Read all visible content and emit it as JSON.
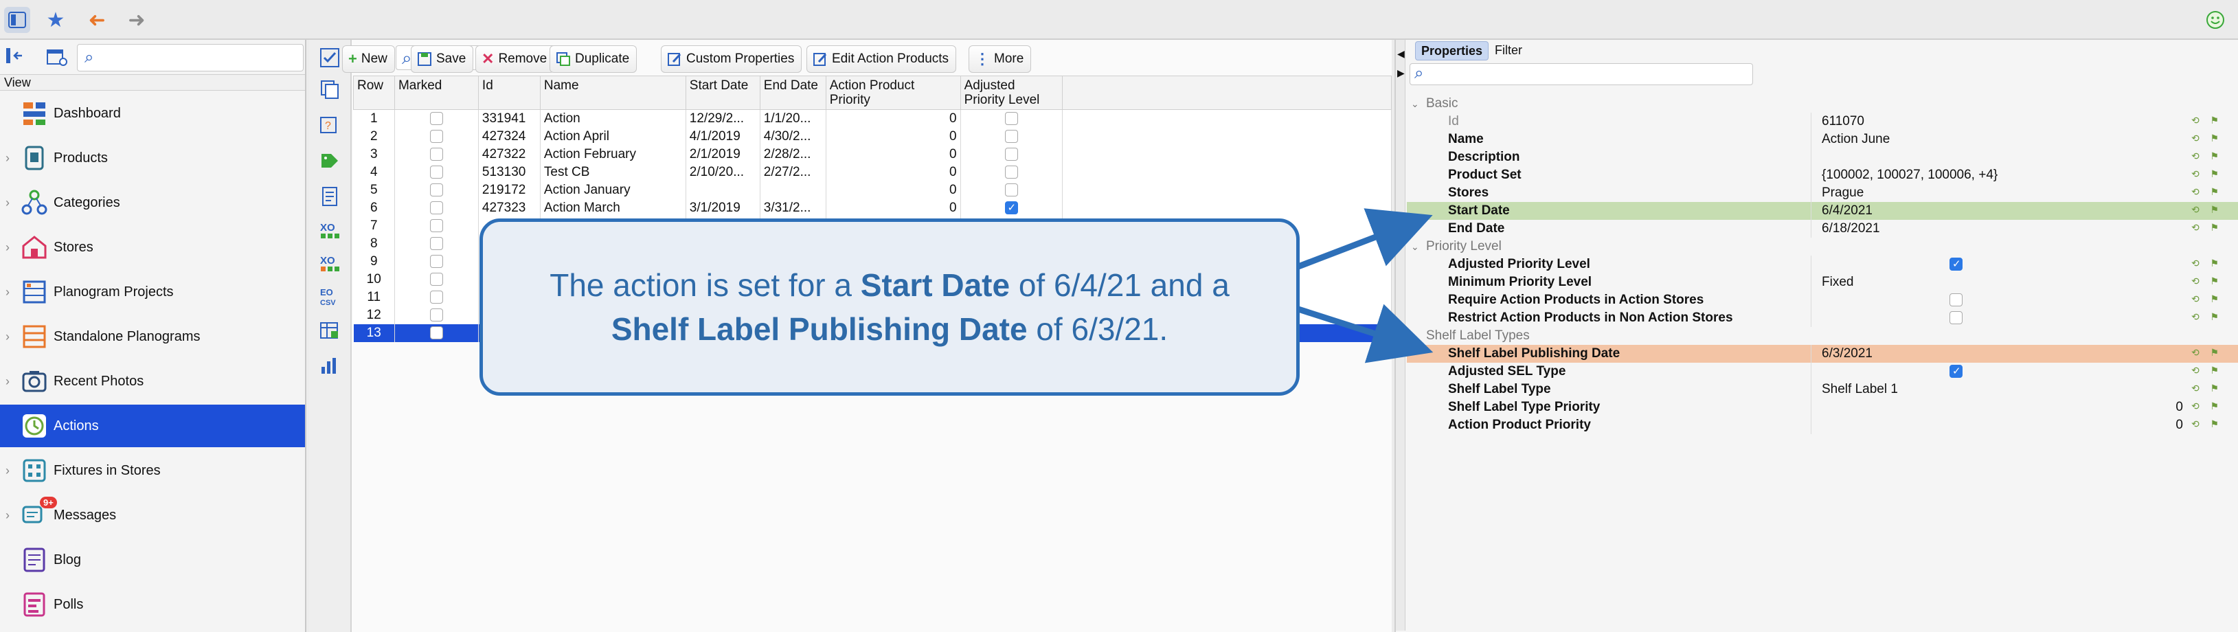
{
  "toolbar": {
    "icons": [
      "sidebar-toggle-icon",
      "star-icon",
      "back-arrow-icon",
      "forward-arrow-icon"
    ],
    "status_icon": "smiley-icon"
  },
  "left": {
    "search_placeholder": "",
    "view_label": "View",
    "items": [
      {
        "label": "Dashboard",
        "icon": "dashboard-icon",
        "chevron": false
      },
      {
        "label": "Products",
        "icon": "products-icon",
        "chevron": true
      },
      {
        "label": "Categories",
        "icon": "categories-icon",
        "chevron": true
      },
      {
        "label": "Stores",
        "icon": "stores-icon",
        "chevron": true
      },
      {
        "label": "Planogram Projects",
        "icon": "planogram-projects-icon",
        "chevron": true
      },
      {
        "label": "Standalone Planograms",
        "icon": "standalone-planograms-icon",
        "chevron": true
      },
      {
        "label": "Recent Photos",
        "icon": "camera-icon",
        "chevron": true
      },
      {
        "label": "Actions",
        "icon": "actions-icon",
        "chevron": false,
        "selected": true
      },
      {
        "label": "Fixtures in Stores",
        "icon": "fixtures-icon",
        "chevron": true
      },
      {
        "label": "Messages",
        "icon": "messages-icon",
        "chevron": true,
        "badge": "9+"
      },
      {
        "label": "Blog",
        "icon": "blog-icon",
        "chevron": false
      },
      {
        "label": "Polls",
        "icon": "polls-icon",
        "chevron": false
      }
    ]
  },
  "middle": {
    "search_placeholder": "",
    "buttons": [
      {
        "label": "New",
        "icon": "plus-icon"
      },
      {
        "label": "Save",
        "icon": "save-icon"
      },
      {
        "label": "Remove",
        "icon": "remove-icon"
      },
      {
        "label": "Duplicate",
        "icon": "duplicate-icon"
      },
      {
        "label": "Custom Properties",
        "icon": "edit-icon"
      },
      {
        "label": "Edit Action Products",
        "icon": "edit-icon"
      },
      {
        "label": "More",
        "icon": "more-icon"
      }
    ],
    "columns": [
      "Row",
      "Marked",
      "Id",
      "Name",
      "Start Date",
      "End Date",
      "Action Product Priority",
      "Adjusted Priority Level"
    ],
    "rows": [
      {
        "row": "1",
        "id": "331941",
        "name": "Action",
        "start": "12/29/2...",
        "end": "1/1/20...",
        "priority": "0",
        "adjusted": false
      },
      {
        "row": "2",
        "id": "427324",
        "name": "Action April",
        "start": "4/1/2019",
        "end": "4/30/2...",
        "priority": "0",
        "adjusted": false
      },
      {
        "row": "3",
        "id": "427322",
        "name": "Action February",
        "start": "2/1/2019",
        "end": "2/28/2...",
        "priority": "0",
        "adjusted": false
      },
      {
        "row": "4",
        "id": "513130",
        "name": "Test CB",
        "start": "2/10/20...",
        "end": "2/27/2...",
        "priority": "0",
        "adjusted": false
      },
      {
        "row": "5",
        "id": "219172",
        "name": "Action January",
        "start": "",
        "end": "",
        "priority": "0",
        "adjusted": false
      },
      {
        "row": "6",
        "id": "427323",
        "name": "Action March",
        "start": "3/1/2019",
        "end": "3/31/2...",
        "priority": "0",
        "adjusted": true
      },
      {
        "row": "7",
        "id": "",
        "name": "",
        "start": "",
        "end": "",
        "priority": "",
        "adjusted": null
      },
      {
        "row": "8",
        "id": "",
        "name": "",
        "start": "",
        "end": "",
        "priority": "",
        "adjusted": null
      },
      {
        "row": "9",
        "id": "",
        "name": "",
        "start": "",
        "end": "",
        "priority": "",
        "adjusted": null
      },
      {
        "row": "10",
        "id": "",
        "name": "",
        "start": "",
        "end": "",
        "priority": "",
        "adjusted": null
      },
      {
        "row": "11",
        "id": "",
        "name": "",
        "start": "",
        "end": "",
        "priority": "",
        "adjusted": null
      },
      {
        "row": "12",
        "id": "",
        "name": "",
        "start": "",
        "end": "",
        "priority": "",
        "adjusted": null
      },
      {
        "row": "13",
        "id": "",
        "name": "",
        "start": "",
        "end": "",
        "priority": "",
        "adjusted": null,
        "selected": true
      }
    ]
  },
  "right": {
    "tabs": [
      "Properties",
      "Filter"
    ],
    "search_placeholder": "",
    "sections": {
      "basic": "Basic",
      "priority": "Priority Level",
      "shelf": "Shelf Label Types"
    },
    "props": {
      "id": {
        "k": "Id",
        "v": "611070"
      },
      "name": {
        "k": "Name",
        "v": "Action June"
      },
      "description": {
        "k": "Description",
        "v": ""
      },
      "product_set": {
        "k": "Product Set",
        "v": "{100002, 100027, 100006, +4}"
      },
      "stores": {
        "k": "Stores",
        "v": "Prague"
      },
      "start_date": {
        "k": "Start Date",
        "v": "6/4/2021"
      },
      "end_date": {
        "k": "End Date",
        "v": "6/18/2021"
      },
      "adj_priority": {
        "k": "Adjusted Priority Level",
        "checked": true
      },
      "min_priority": {
        "k": "Minimum Priority Level",
        "v": "Fixed"
      },
      "require_ap": {
        "k": "Require Action Products in Action Stores",
        "checked": false
      },
      "restrict_ap": {
        "k": "Restrict Action Products in Non Action Stores",
        "checked": false
      },
      "sl_pub_date": {
        "k": "Shelf Label Publishing Date",
        "v": "6/3/2021"
      },
      "adj_sel_type": {
        "k": "Adjusted SEL Type",
        "checked": true
      },
      "sl_type": {
        "k": "Shelf Label Type",
        "v": "Shelf Label 1"
      },
      "sl_type_priority": {
        "k": "Shelf Label Type Priority",
        "v": "0"
      },
      "ap_priority": {
        "k": "Action Product Priority",
        "v": "0"
      }
    },
    "highlight_colors": {
      "start": "#c6ddb1",
      "shelf": "#f3c4a5"
    }
  },
  "callout": {
    "part1": "The action is set for a ",
    "bold1": "Start Date",
    "part2": " of 6/4/21 and a ",
    "bold2": "Shelf Label Publishing Date",
    "part3": " of 6/3/21."
  }
}
